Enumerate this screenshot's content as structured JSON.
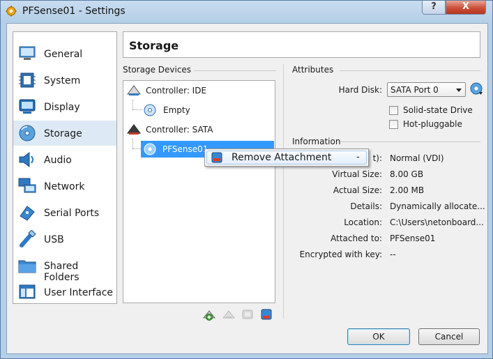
{
  "window": {
    "title": "PFSense01 - Settings",
    "help_label": "?",
    "close_label": "X"
  },
  "sidebar": {
    "items": [
      {
        "label": "General",
        "icon": "monitor-icon"
      },
      {
        "label": "System",
        "icon": "chip-icon"
      },
      {
        "label": "Display",
        "icon": "display-icon"
      },
      {
        "label": "Storage",
        "icon": "disk-icon",
        "selected": true
      },
      {
        "label": "Audio",
        "icon": "speaker-icon"
      },
      {
        "label": "Network",
        "icon": "network-icon"
      },
      {
        "label": "Serial Ports",
        "icon": "serial-icon"
      },
      {
        "label": "USB",
        "icon": "usb-icon"
      },
      {
        "label": "Shared Folders",
        "icon": "folder-icon"
      },
      {
        "label": "User Interface",
        "icon": "ui-icon"
      }
    ]
  },
  "page": {
    "title": "Storage"
  },
  "storage_devices": {
    "heading": "Storage Devices",
    "controllers": [
      {
        "label": "Controller: IDE",
        "attachments": [
          {
            "label": "Empty"
          }
        ]
      },
      {
        "label": "Controller: SATA",
        "attachments": [
          {
            "label": "PFSense01"
          }
        ]
      }
    ]
  },
  "attributes": {
    "heading": "Attributes",
    "hard_disk_label": "Hard Disk:",
    "hard_disk_value": "SATA Port 0",
    "solid_state_label": "Solid-state Drive",
    "hot_pluggable_label": "Hot-pluggable"
  },
  "information": {
    "heading": "Information",
    "type_label_fragment": "t):",
    "type_value": "Normal (VDI)",
    "rows": [
      {
        "label": "Virtual Size:",
        "value": "8.00 GB"
      },
      {
        "label": "Actual Size:",
        "value": "2.00 MB"
      },
      {
        "label": "Details:",
        "value": "Dynamically allocate..."
      },
      {
        "label": "Location:",
        "value": "C:\\Users\\netonboard..."
      },
      {
        "label": "Attached to:",
        "value": "PFSense01"
      },
      {
        "label": "Encrypted with key:",
        "value": "--"
      }
    ]
  },
  "context_menu": {
    "item_label": "Remove Attachment",
    "item_shortcut": "-"
  },
  "buttons": {
    "ok": "OK",
    "cancel": "Cancel"
  },
  "colors": {
    "selection": "#3399ff",
    "window_frame": "#b5cfe8",
    "close_button": "#c9503a"
  }
}
